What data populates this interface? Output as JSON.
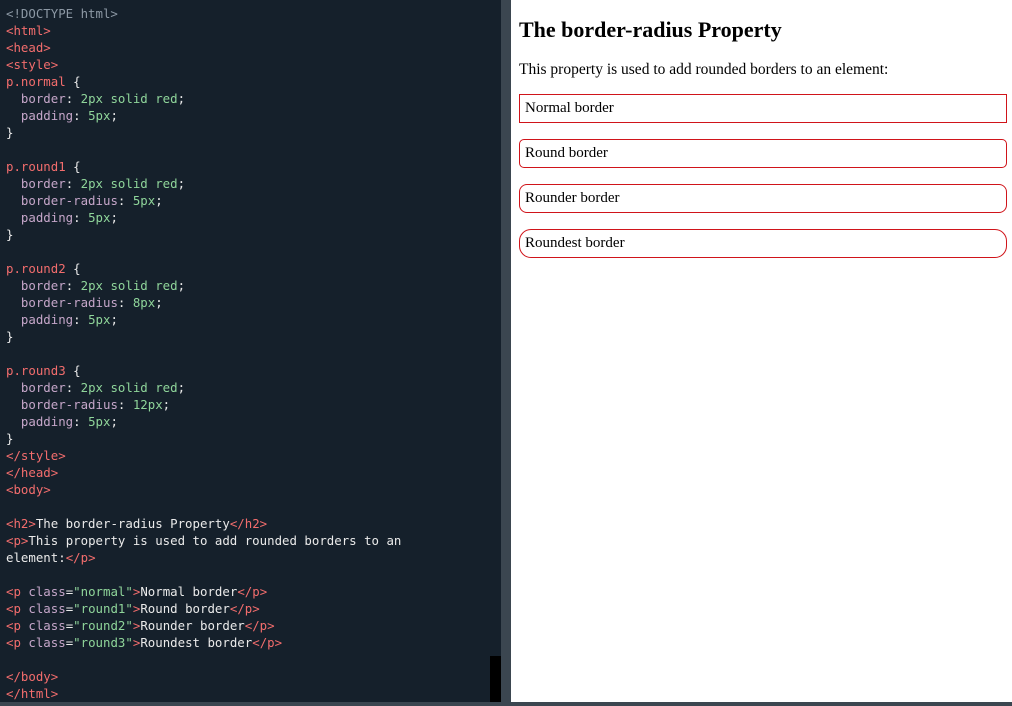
{
  "editor": {
    "lines": [
      [
        {
          "c": "t-doctype",
          "t": "<!DOCTYPE html>"
        }
      ],
      [
        {
          "c": "t-tag",
          "t": "<html>"
        }
      ],
      [
        {
          "c": "t-tag",
          "t": "<head>"
        }
      ],
      [
        {
          "c": "t-tag",
          "t": "<style>"
        }
      ],
      [
        {
          "c": "t-sel",
          "t": "p.normal"
        },
        {
          "c": "t-punc",
          "t": " {"
        }
      ],
      [
        {
          "c": "t-punc",
          "t": "  "
        },
        {
          "c": "t-prop",
          "t": "border"
        },
        {
          "c": "t-punc",
          "t": ": "
        },
        {
          "c": "t-val",
          "t": "2px solid red"
        },
        {
          "c": "t-punc",
          "t": ";"
        }
      ],
      [
        {
          "c": "t-punc",
          "t": "  "
        },
        {
          "c": "t-prop",
          "t": "padding"
        },
        {
          "c": "t-punc",
          "t": ": "
        },
        {
          "c": "t-val",
          "t": "5px"
        },
        {
          "c": "t-punc",
          "t": ";"
        }
      ],
      [
        {
          "c": "t-punc",
          "t": "}"
        }
      ],
      [],
      [
        {
          "c": "t-sel",
          "t": "p.round1"
        },
        {
          "c": "t-punc",
          "t": " {"
        }
      ],
      [
        {
          "c": "t-punc",
          "t": "  "
        },
        {
          "c": "t-prop",
          "t": "border"
        },
        {
          "c": "t-punc",
          "t": ": "
        },
        {
          "c": "t-val",
          "t": "2px solid red"
        },
        {
          "c": "t-punc",
          "t": ";"
        }
      ],
      [
        {
          "c": "t-punc",
          "t": "  "
        },
        {
          "c": "t-prop",
          "t": "border-radius"
        },
        {
          "c": "t-punc",
          "t": ": "
        },
        {
          "c": "t-val",
          "t": "5px"
        },
        {
          "c": "t-punc",
          "t": ";"
        }
      ],
      [
        {
          "c": "t-punc",
          "t": "  "
        },
        {
          "c": "t-prop",
          "t": "padding"
        },
        {
          "c": "t-punc",
          "t": ": "
        },
        {
          "c": "t-val",
          "t": "5px"
        },
        {
          "c": "t-punc",
          "t": ";"
        }
      ],
      [
        {
          "c": "t-punc",
          "t": "}"
        }
      ],
      [],
      [
        {
          "c": "t-sel",
          "t": "p.round2"
        },
        {
          "c": "t-punc",
          "t": " {"
        }
      ],
      [
        {
          "c": "t-punc",
          "t": "  "
        },
        {
          "c": "t-prop",
          "t": "border"
        },
        {
          "c": "t-punc",
          "t": ": "
        },
        {
          "c": "t-val",
          "t": "2px solid red"
        },
        {
          "c": "t-punc",
          "t": ";"
        }
      ],
      [
        {
          "c": "t-punc",
          "t": "  "
        },
        {
          "c": "t-prop",
          "t": "border-radius"
        },
        {
          "c": "t-punc",
          "t": ": "
        },
        {
          "c": "t-val",
          "t": "8px"
        },
        {
          "c": "t-punc",
          "t": ";"
        }
      ],
      [
        {
          "c": "t-punc",
          "t": "  "
        },
        {
          "c": "t-prop",
          "t": "padding"
        },
        {
          "c": "t-punc",
          "t": ": "
        },
        {
          "c": "t-val",
          "t": "5px"
        },
        {
          "c": "t-punc",
          "t": ";"
        }
      ],
      [
        {
          "c": "t-punc",
          "t": "}"
        }
      ],
      [],
      [
        {
          "c": "t-sel",
          "t": "p.round3"
        },
        {
          "c": "t-punc",
          "t": " {"
        }
      ],
      [
        {
          "c": "t-punc",
          "t": "  "
        },
        {
          "c": "t-prop",
          "t": "border"
        },
        {
          "c": "t-punc",
          "t": ": "
        },
        {
          "c": "t-val",
          "t": "2px solid red"
        },
        {
          "c": "t-punc",
          "t": ";"
        }
      ],
      [
        {
          "c": "t-punc",
          "t": "  "
        },
        {
          "c": "t-prop",
          "t": "border-radius"
        },
        {
          "c": "t-punc",
          "t": ": "
        },
        {
          "c": "t-val",
          "t": "12px"
        },
        {
          "c": "t-punc",
          "t": ";"
        }
      ],
      [
        {
          "c": "t-punc",
          "t": "  "
        },
        {
          "c": "t-prop",
          "t": "padding"
        },
        {
          "c": "t-punc",
          "t": ": "
        },
        {
          "c": "t-val",
          "t": "5px"
        },
        {
          "c": "t-punc",
          "t": ";"
        }
      ],
      [
        {
          "c": "t-punc",
          "t": "}"
        }
      ],
      [
        {
          "c": "t-tag",
          "t": "</style>"
        }
      ],
      [
        {
          "c": "t-tag",
          "t": "</head>"
        }
      ],
      [
        {
          "c": "t-tag",
          "t": "<body>"
        }
      ],
      [],
      [
        {
          "c": "t-tag",
          "t": "<h2>"
        },
        {
          "c": "t-text",
          "t": "The border-radius Property"
        },
        {
          "c": "t-tag",
          "t": "</h2>"
        }
      ],
      [
        {
          "c": "t-tag",
          "t": "<p>"
        },
        {
          "c": "t-text",
          "t": "This property is used to add rounded borders to an"
        }
      ],
      [
        {
          "c": "t-text",
          "t": "element:"
        },
        {
          "c": "t-tag",
          "t": "</p>"
        }
      ],
      [],
      [
        {
          "c": "t-tag",
          "t": "<p "
        },
        {
          "c": "t-attr",
          "t": "class"
        },
        {
          "c": "t-punc",
          "t": "="
        },
        {
          "c": "t-str",
          "t": "\"normal\""
        },
        {
          "c": "t-tag",
          "t": ">"
        },
        {
          "c": "t-text",
          "t": "Normal border"
        },
        {
          "c": "t-tag",
          "t": "</p>"
        }
      ],
      [
        {
          "c": "t-tag",
          "t": "<p "
        },
        {
          "c": "t-attr",
          "t": "class"
        },
        {
          "c": "t-punc",
          "t": "="
        },
        {
          "c": "t-str",
          "t": "\"round1\""
        },
        {
          "c": "t-tag",
          "t": ">"
        },
        {
          "c": "t-text",
          "t": "Round border"
        },
        {
          "c": "t-tag",
          "t": "</p>"
        }
      ],
      [
        {
          "c": "t-tag",
          "t": "<p "
        },
        {
          "c": "t-attr",
          "t": "class"
        },
        {
          "c": "t-punc",
          "t": "="
        },
        {
          "c": "t-str",
          "t": "\"round2\""
        },
        {
          "c": "t-tag",
          "t": ">"
        },
        {
          "c": "t-text",
          "t": "Rounder border"
        },
        {
          "c": "t-tag",
          "t": "</p>"
        }
      ],
      [
        {
          "c": "t-tag",
          "t": "<p "
        },
        {
          "c": "t-attr",
          "t": "class"
        },
        {
          "c": "t-punc",
          "t": "="
        },
        {
          "c": "t-str",
          "t": "\"round3\""
        },
        {
          "c": "t-tag",
          "t": ">"
        },
        {
          "c": "t-text",
          "t": "Roundest border"
        },
        {
          "c": "t-tag",
          "t": "</p>"
        }
      ],
      [],
      [
        {
          "c": "t-tag",
          "t": "</body>"
        }
      ],
      [
        {
          "c": "t-tag",
          "t": "</html>"
        }
      ]
    ]
  },
  "preview": {
    "heading": "The border-radius Property",
    "intro": "This property is used to add rounded borders to an element:",
    "boxes": {
      "normal": "Normal border",
      "round1": "Round border",
      "round2": "Rounder border",
      "round3": "Roundest border"
    },
    "border_color": "#d0141a"
  },
  "colors": {
    "editor_bg": "#15202b",
    "tag": "#f36d6d",
    "property": "#c5a6c9",
    "value": "#8fd59a",
    "text": "#eaeaea",
    "doctype": "#8c98a4"
  }
}
